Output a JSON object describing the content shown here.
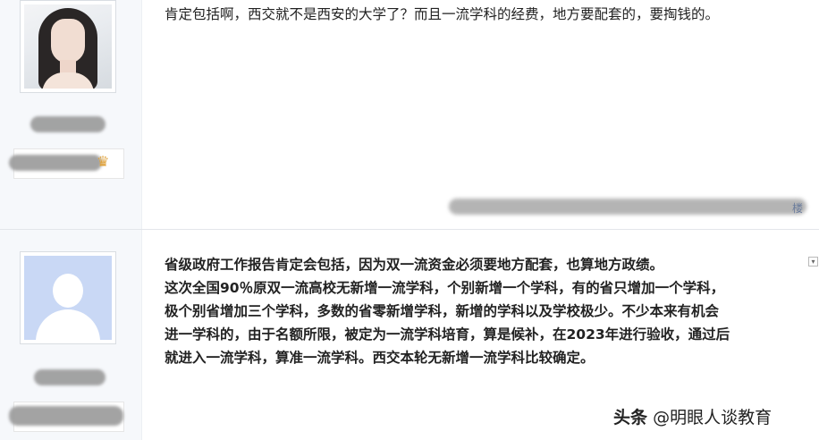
{
  "posts": [
    {
      "avatar": "user-photo",
      "username": "",
      "text": "肯定包括啊，西交就不是西安的大学了？而且一流学科的经费，地方要配套的，要掏钱的。",
      "meta_tail": "楼"
    },
    {
      "avatar": "default-avatar",
      "username": "",
      "lines": [
        "省级政府工作报告肯定会包括，因为双一流资金必须要地方配套，也算地方政绩。",
        "这次全国90％原双一流高校无新增一流学科，个别新增一个学科，有的省只增加一个学科，",
        "极个别省增加三个学科，多数的省零新增学科，新增的学科以及学校极少。不少本来有机会",
        "进一学科的，由于名额所限，被定为一流学科培育，算是候补，在2023年进行验收，通过后",
        "就进入一流学科，算准一流学科。西交本轮无新增一流学科比较确定。"
      ]
    }
  ],
  "watermark": {
    "platform": "头条",
    "account": "@明眼人谈教育"
  },
  "colors": {
    "sidebar_bg": "#f6f8fb",
    "meta_link": "#6a7c9c",
    "default_avatar_bg": "#c9d8f5"
  }
}
